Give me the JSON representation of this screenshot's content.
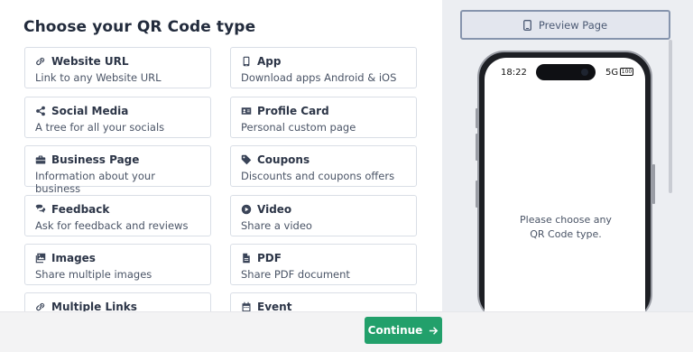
{
  "page": {
    "title": "Choose your QR Code type"
  },
  "types": [
    {
      "icon": "link-icon",
      "title": "Website URL",
      "desc": "Link to any Website URL"
    },
    {
      "icon": "mobile-icon",
      "title": "App",
      "desc": "Download apps Android & iOS"
    },
    {
      "icon": "share-icon",
      "title": "Social Media",
      "desc": "A tree for all your socials"
    },
    {
      "icon": "id-card-icon",
      "title": "Profile Card",
      "desc": "Personal custom page"
    },
    {
      "icon": "briefcase-icon",
      "title": "Business Page",
      "desc": "Information about your business"
    },
    {
      "icon": "tag-icon",
      "title": "Coupons",
      "desc": "Discounts and coupons offers"
    },
    {
      "icon": "comments-icon",
      "title": "Feedback",
      "desc": "Ask for feedback and reviews"
    },
    {
      "icon": "play-circle-icon",
      "title": "Video",
      "desc": "Share a video"
    },
    {
      "icon": "images-icon",
      "title": "Images",
      "desc": "Share multiple images"
    },
    {
      "icon": "file-pdf-icon",
      "title": "PDF",
      "desc": "Share PDF document"
    },
    {
      "icon": "link-icon",
      "title": "Multiple Links",
      "desc": ""
    },
    {
      "icon": "calendar-icon",
      "title": "Event",
      "desc": ""
    }
  ],
  "preview": {
    "button_label": "Preview Page",
    "time": "18:22",
    "network": "5G",
    "battery": "100",
    "message_line1": "Please choose any",
    "message_line2": "QR Code type."
  },
  "footer": {
    "continue_label": "Continue"
  },
  "colors": {
    "accent": "#22a06b",
    "preview_border": "#8694ad"
  }
}
